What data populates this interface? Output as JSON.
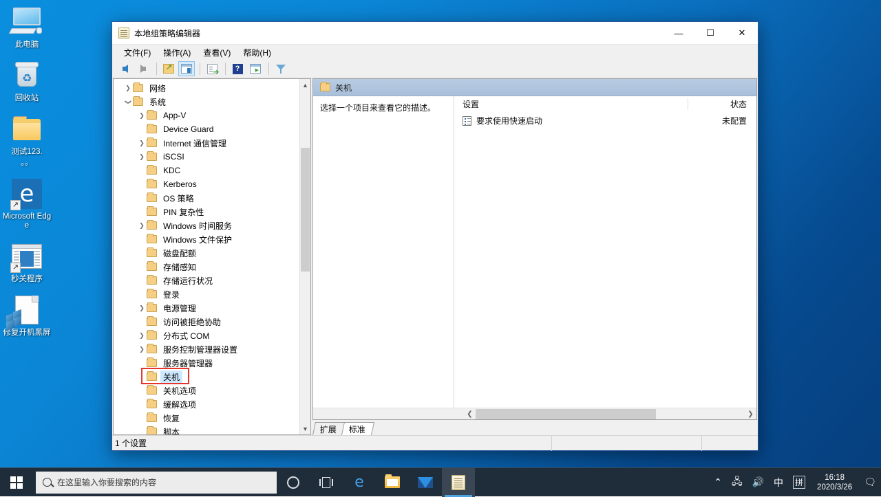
{
  "desktop": {
    "icons": [
      {
        "name": "this-pc",
        "label": "此电脑",
        "icon": "computer-icon"
      },
      {
        "name": "recycle-bin",
        "label": "回收站",
        "icon": "recycle-bin-icon"
      },
      {
        "name": "test123",
        "label": "测试123.",
        "icon": "folder-icon",
        "sublabel": "。。"
      },
      {
        "name": "microsoft-edge",
        "label": "Microsoft Edge",
        "icon": "edge-icon"
      },
      {
        "name": "quick-shutdown",
        "label": "秒关程序",
        "icon": "program-window-icon"
      },
      {
        "name": "fix-black-screen",
        "label": "修复开机黑屏",
        "icon": "document-blocks-icon"
      }
    ]
  },
  "taskbar": {
    "start_label": "start-button",
    "search": {
      "placeholder": "在这里输入你要搜索的内容",
      "icon": "search-icon"
    },
    "buttons": [
      {
        "name": "cortana",
        "icon": "cortana-circle-icon",
        "active": false
      },
      {
        "name": "task-view",
        "icon": "task-view-icon",
        "active": false
      },
      {
        "name": "edge",
        "icon": "edge-icon",
        "active": false
      },
      {
        "name": "file-explorer",
        "icon": "folder-icon",
        "active": false
      },
      {
        "name": "mail",
        "icon": "mail-icon",
        "active": false
      },
      {
        "name": "group-policy-editor",
        "icon": "scroll-icon",
        "active": true
      }
    ],
    "tray": {
      "chevron": "⌃",
      "network": "network-icon",
      "volume": "volume-icon",
      "ime_lang": "中",
      "ime_pinyin": "拼",
      "time": "16:18",
      "date": "2020/3/26",
      "action_center": "notification-icon"
    }
  },
  "window": {
    "title": "本地组策略编辑器",
    "icon": "scroll-icon",
    "controls": {
      "minimize": "—",
      "maximize": "☐",
      "close": "✕"
    },
    "menu": [
      "文件(F)",
      "操作(A)",
      "查看(V)",
      "帮助(H)"
    ],
    "toolbar": [
      {
        "name": "back-button",
        "icon": "arrow-left-icon",
        "selected": false
      },
      {
        "name": "forward-button",
        "icon": "arrow-right-icon",
        "selected": false
      },
      {
        "name": "up-one-level-button",
        "icon": "folder-up-icon",
        "selected": false
      },
      {
        "name": "show-hide-tree-button",
        "icon": "panes-icon",
        "selected": true
      },
      {
        "name": "export-list-button",
        "icon": "export-icon",
        "selected": false
      },
      {
        "name": "help-button",
        "icon": "help-icon",
        "selected": false
      },
      {
        "name": "run-button",
        "icon": "run-window-icon",
        "selected": false
      },
      {
        "name": "filter-button",
        "icon": "filter-icon",
        "selected": false
      }
    ],
    "tree": {
      "items": [
        {
          "label": "网络",
          "indent": 1,
          "chevron": ">",
          "selected": false
        },
        {
          "label": "系统",
          "indent": 1,
          "chevron": "v",
          "selected": false
        },
        {
          "label": "App-V",
          "indent": 2,
          "chevron": ">",
          "selected": false
        },
        {
          "label": "Device Guard",
          "indent": 2,
          "chevron": "",
          "selected": false
        },
        {
          "label": "Internet 通信管理",
          "indent": 2,
          "chevron": ">",
          "selected": false
        },
        {
          "label": "iSCSI",
          "indent": 2,
          "chevron": ">",
          "selected": false
        },
        {
          "label": "KDC",
          "indent": 2,
          "chevron": "",
          "selected": false
        },
        {
          "label": "Kerberos",
          "indent": 2,
          "chevron": "",
          "selected": false
        },
        {
          "label": "OS 策略",
          "indent": 2,
          "chevron": "",
          "selected": false
        },
        {
          "label": "PIN 复杂性",
          "indent": 2,
          "chevron": "",
          "selected": false
        },
        {
          "label": "Windows 时间服务",
          "indent": 2,
          "chevron": ">",
          "selected": false
        },
        {
          "label": "Windows 文件保护",
          "indent": 2,
          "chevron": "",
          "selected": false
        },
        {
          "label": "磁盘配额",
          "indent": 2,
          "chevron": "",
          "selected": false
        },
        {
          "label": "存储感知",
          "indent": 2,
          "chevron": "",
          "selected": false
        },
        {
          "label": "存储运行状况",
          "indent": 2,
          "chevron": "",
          "selected": false
        },
        {
          "label": "登录",
          "indent": 2,
          "chevron": "",
          "selected": false
        },
        {
          "label": "电源管理",
          "indent": 2,
          "chevron": ">",
          "selected": false
        },
        {
          "label": "访问被拒绝协助",
          "indent": 2,
          "chevron": "",
          "selected": false
        },
        {
          "label": "分布式 COM",
          "indent": 2,
          "chevron": ">",
          "selected": false
        },
        {
          "label": "服务控制管理器设置",
          "indent": 2,
          "chevron": ">",
          "selected": false
        },
        {
          "label": "服务器管理器",
          "indent": 2,
          "chevron": "",
          "selected": false
        },
        {
          "label": "关机",
          "indent": 2,
          "chevron": "",
          "selected": true
        },
        {
          "label": "关机选项",
          "indent": 2,
          "chevron": "",
          "selected": false
        },
        {
          "label": "缓解选项",
          "indent": 2,
          "chevron": "",
          "selected": false
        },
        {
          "label": "恢复",
          "indent": 2,
          "chevron": "",
          "selected": false
        },
        {
          "label": "脚本",
          "indent": 2,
          "chevron": "",
          "selected": false
        }
      ],
      "highlight_label": "关机",
      "highlight_color": "#e8352b"
    },
    "right_pane": {
      "header_title": "关机",
      "header_icon": "folder-icon",
      "description": "选择一个项目来查看它的描述。",
      "columns": [
        "设置",
        "状态"
      ],
      "rows": [
        {
          "setting": "要求使用快速启动",
          "state": "未配置",
          "icon": "policy-setting-icon"
        }
      ]
    },
    "tabs": [
      {
        "label": "扩展",
        "active": false
      },
      {
        "label": "标准",
        "active": true
      }
    ],
    "statusbar": {
      "text": "1 个设置"
    }
  }
}
